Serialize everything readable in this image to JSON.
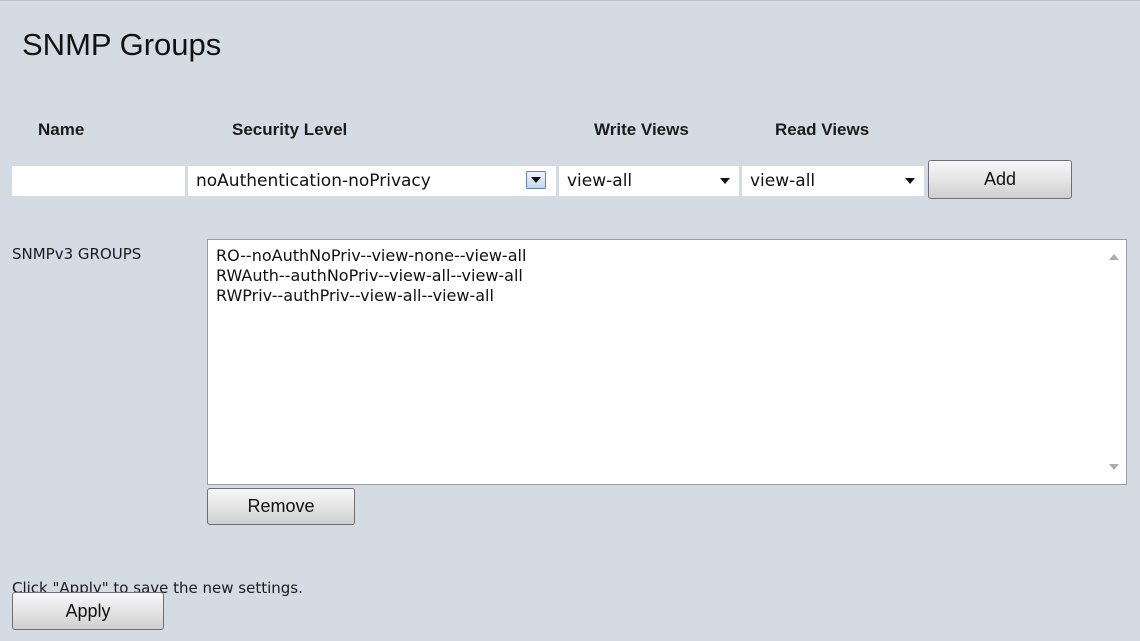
{
  "page": {
    "title": "SNMP Groups"
  },
  "columns": {
    "name": "Name",
    "security_level": "Security Level",
    "write_views": "Write Views",
    "read_views": "Read Views"
  },
  "form": {
    "name_value": "",
    "security_level_value": "noAuthentication-noPrivacy",
    "write_views_value": "view-all",
    "read_views_value": "view-all",
    "add_label": "Add"
  },
  "groups": {
    "label": "SNMPv3 GROUPS",
    "items": [
      "RO--noAuthNoPriv--view-none--view-all",
      "RWAuth--authNoPriv--view-all--view-all",
      "RWPriv--authPriv--view-all--view-all"
    ],
    "remove_label": "Remove"
  },
  "footer": {
    "hint": "Click \"Apply\" to save the new settings.",
    "apply_label": "Apply"
  },
  "icons": {
    "dropdown_arrow": "chevron-down-icon",
    "scroll_up": "scroll-up-icon",
    "scroll_down": "scroll-down-icon"
  },
  "colors": {
    "panel_background": "#d5dbe3",
    "dropdown_button_border": "#5a86b3"
  }
}
